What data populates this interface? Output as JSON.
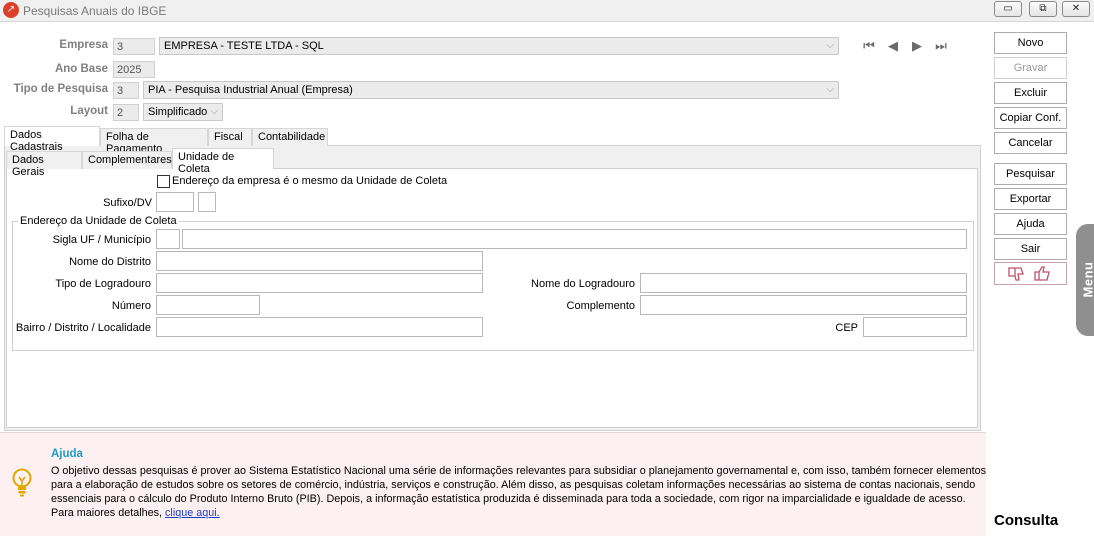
{
  "window": {
    "title": "Pesquisas Anuais do IBGE",
    "controls": {
      "minimize": "▭",
      "restore": "⧉",
      "close": "✕"
    }
  },
  "header": {
    "empresa_label": "Empresa",
    "empresa_code": "3",
    "empresa_name": "EMPRESA - TESTE LTDA - SQL",
    "ano_base_label": "Ano Base",
    "ano_base_value": "2025",
    "tipo_pesquisa_label": "Tipo de Pesquisa",
    "tipo_pesquisa_code": "3",
    "tipo_pesquisa_value": "PIA - Pesquisa Industrial Anual (Empresa)",
    "layout_label": "Layout",
    "layout_code": "2",
    "layout_value": "Simplificado"
  },
  "nav": {
    "first": "⏮",
    "prev": "◀",
    "next": "▶",
    "last": "⏭"
  },
  "tabs": [
    "Dados Cadastrais",
    "Folha de Pagamento",
    "Fiscal",
    "Contabilidade"
  ],
  "subtabs": [
    "Dados Gerais",
    "Complementares",
    "Unidade de Coleta"
  ],
  "form": {
    "same_address_label": "Endereço da empresa é o mesmo da Unidade de Coleta",
    "sufixo_label": "Sufixo/DV",
    "group_title": "Endereço da Unidade de Coleta",
    "uf_municipio_label": "Sigla UF / Município",
    "nome_distrito_label": "Nome do Distrito",
    "tipo_logradouro_label": "Tipo de Logradouro",
    "nome_logradouro_label": "Nome do Logradouro",
    "numero_label": "Número",
    "complemento_label": "Complemento",
    "bairro_label": "Bairro / Distrito / Localidade",
    "cep_label": "CEP"
  },
  "help": {
    "title": "Ajuda",
    "text": "O objetivo dessas pesquisas é prover ao Sistema Estatístico Nacional uma série de informações relevantes para subsidiar o planejamento governamental e, com isso, também fornecer elementos para a elaboração de estudos sobre os setores de comércio, indústria, serviços e construção. Além disso, as pesquisas coletam informações necessárias ao sistema de contas nacionais, sendo essenciais para o cálculo do Produto Interno Bruto (PIB). Depois, a informação estatística produzida é disseminada para toda a sociedade, com rigor na imparcialidade e igualdade de acesso.",
    "more_prefix": "Para maiores detalhes,",
    "link": "clique aqui."
  },
  "sidebar": {
    "novo": "Novo",
    "gravar": "Gravar",
    "excluir": "Excluir",
    "copiar": "Copiar Conf.",
    "cancelar": "Cancelar",
    "pesquisar": "Pesquisar",
    "exportar": "Exportar",
    "ajuda": "Ajuda",
    "sair": "Sair",
    "menu": "Menu",
    "mode": "Consulta"
  },
  "colors": {
    "help_title": "#1e9cc4",
    "link": "#1a3ec6",
    "help_bg": "#fdf0f2",
    "thumb": "#c0506d"
  }
}
